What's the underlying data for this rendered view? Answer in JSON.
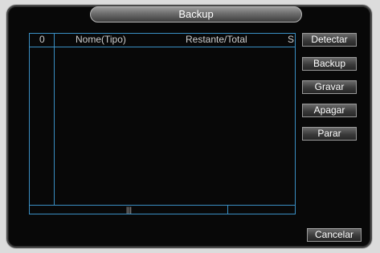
{
  "window": {
    "title": "Backup"
  },
  "list": {
    "columns": [
      "0",
      "Nome(Tipo)",
      "Restante/Total",
      "S"
    ],
    "scroll_thumb": "|||"
  },
  "buttons": {
    "detect": "Detectar",
    "backup": "Backup",
    "record": "Gravar",
    "erase": "Apagar",
    "stop": "Parar",
    "cancel": "Cancelar"
  },
  "colors": {
    "accent_border": "#3a8fc4",
    "window_bg": "#080808",
    "page_bg": "#dcdcdc"
  }
}
